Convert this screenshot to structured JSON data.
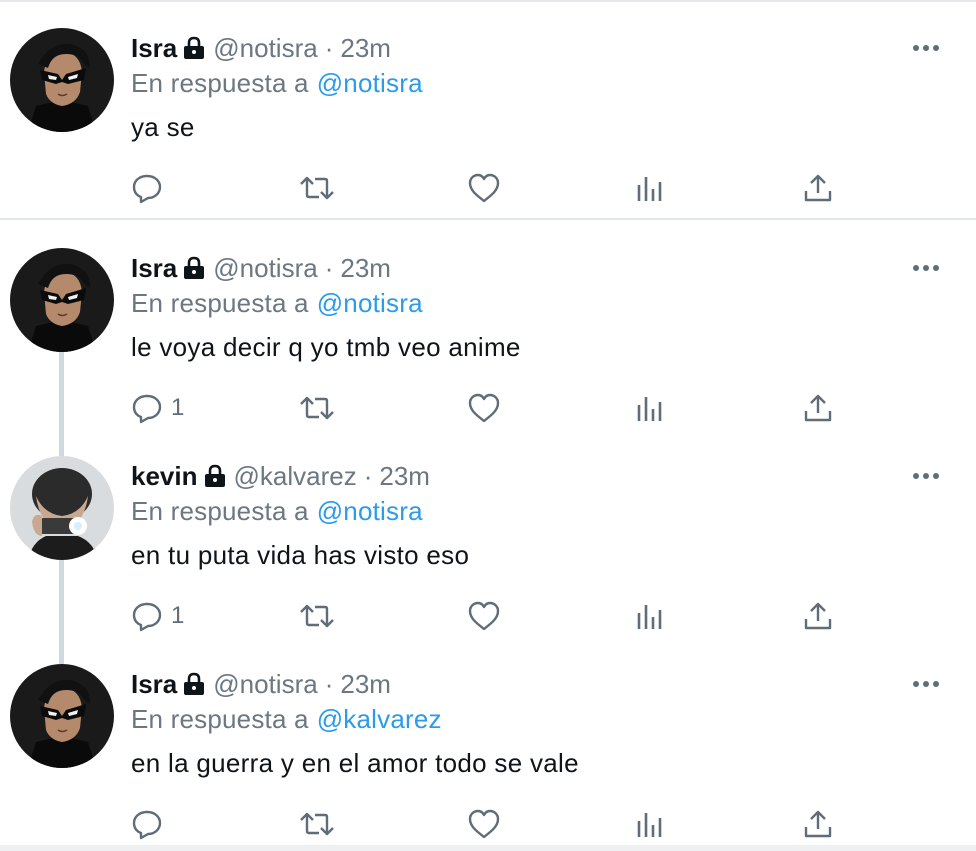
{
  "tweets": [
    {
      "name": "Isra",
      "handle": "@notisra",
      "time": "23m",
      "reply_prefix": "En respuesta a",
      "reply_to": "@notisra",
      "text": "ya se",
      "reply_count": "",
      "avatar": "masked-hero-avatar"
    },
    {
      "name": "Isra",
      "handle": "@notisra",
      "time": "23m",
      "reply_prefix": "En respuesta a",
      "reply_to": "@notisra",
      "text": "le voya decir q yo tmb veo anime",
      "reply_count": "1",
      "avatar": "masked-hero-avatar"
    },
    {
      "name": "kevin",
      "handle": "@kalvarez",
      "time": "23m",
      "reply_prefix": "En respuesta a",
      "reply_to": "@notisra",
      "text": "en tu puta vida has visto eso",
      "reply_count": "1",
      "avatar": "photo-camera-avatar"
    },
    {
      "name": "Isra",
      "handle": "@notisra",
      "time": "23m",
      "reply_prefix": "En respuesta a",
      "reply_to": "@kalvarez",
      "text": "en la guerra y en el amor todo se vale",
      "reply_count": "",
      "avatar": "masked-hero-avatar"
    }
  ],
  "separator": "·",
  "colors": {
    "text": "#0f1419",
    "muted": "#6b7781",
    "link": "#2b9bea",
    "icon": "#5f6d78",
    "divider": "#e1e6ea"
  },
  "icons": [
    "reply-icon",
    "retweet-icon",
    "like-icon",
    "views-icon",
    "share-icon",
    "more-icon",
    "lock-icon"
  ]
}
